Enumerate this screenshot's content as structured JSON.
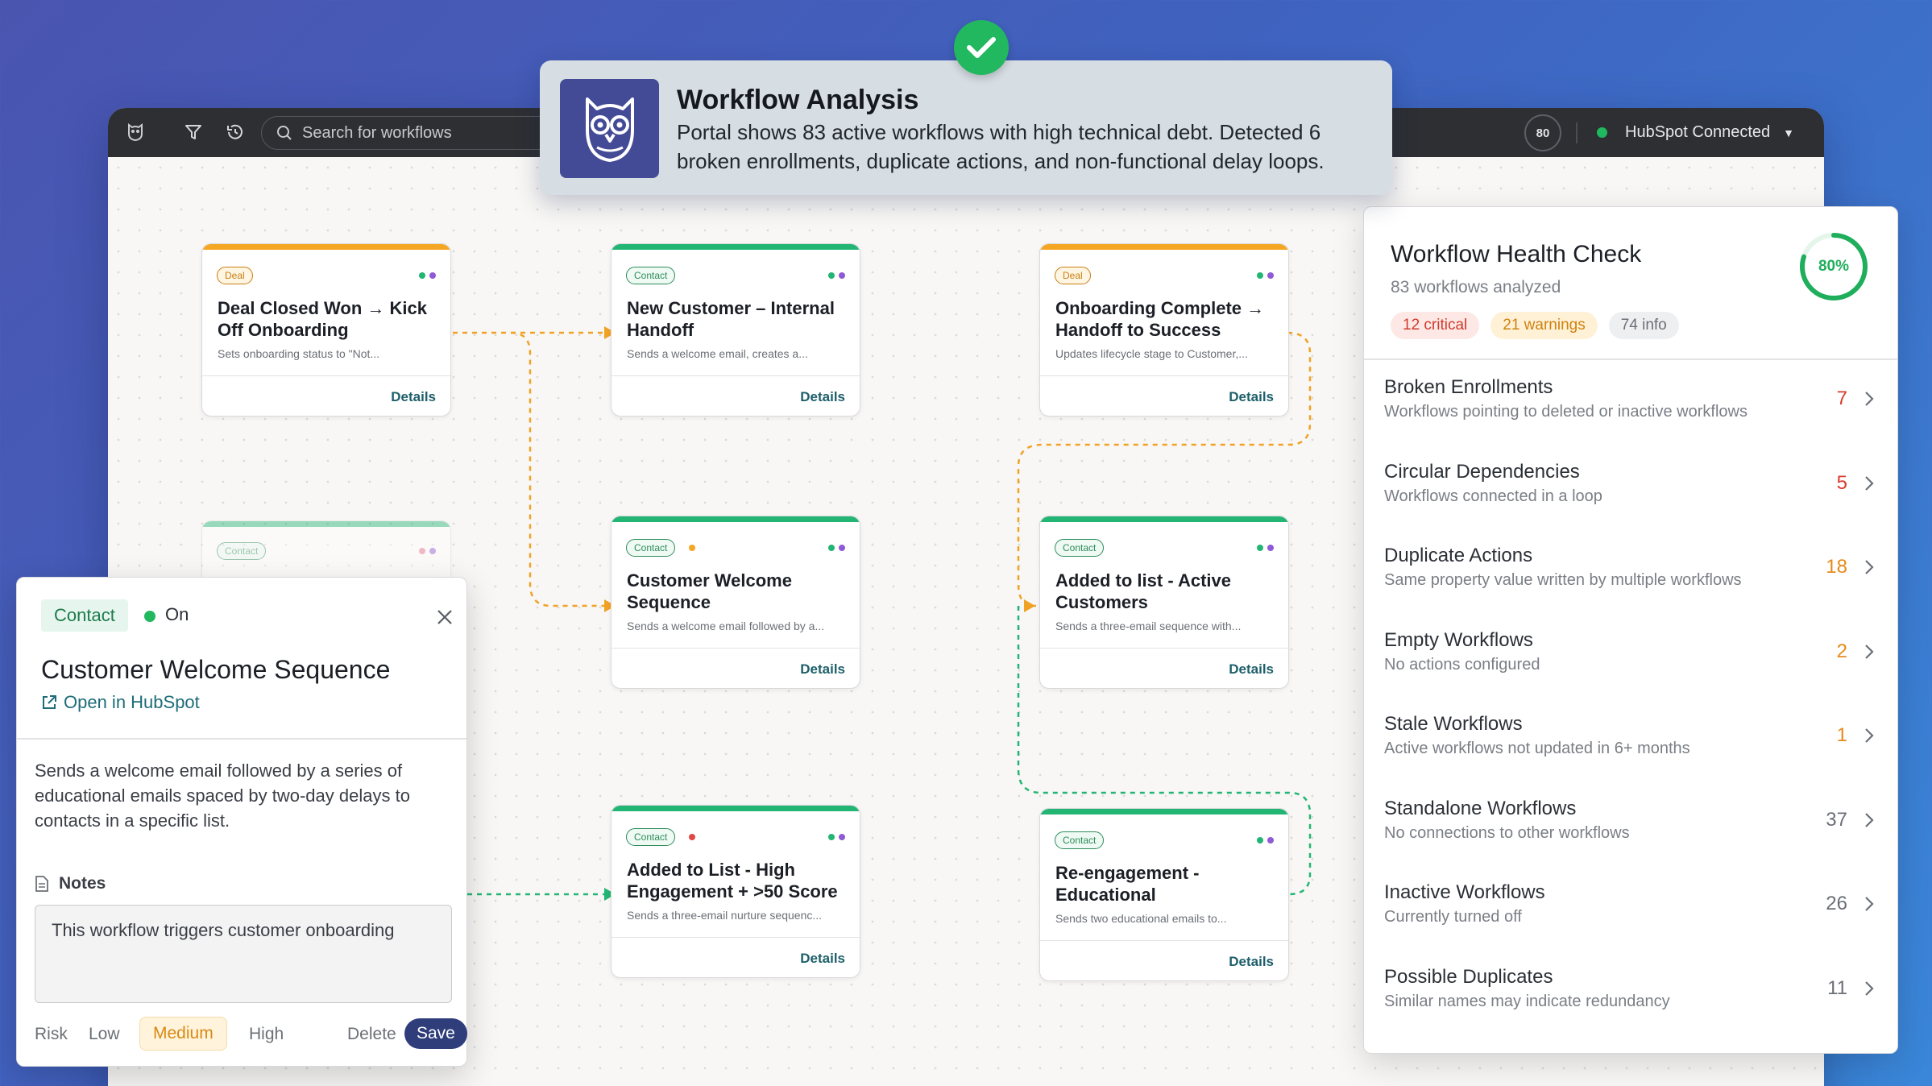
{
  "toolbar": {
    "search_placeholder": "Search for workflows",
    "credits": "80",
    "connection_label": "HubSpot Connected"
  },
  "banner": {
    "title": "Workflow Analysis",
    "text": "Portal shows 83 active workflows with high technical debt. Detected 6 broken enrollments, duplicate actions, and non-functional delay loops."
  },
  "nodes": [
    {
      "tag": "Deal",
      "title": "Deal Closed Won → Kick Off Onboarding",
      "desc": "Sets onboarding status to \"Not...",
      "details": "Details"
    },
    {
      "tag": "Contact",
      "title": "New Customer – Internal Handoff",
      "desc": "Sends a welcome email, creates a...",
      "details": "Details"
    },
    {
      "tag": "Deal",
      "title": "Onboarding Complete → Handoff to Success",
      "desc": "Updates lifecycle stage to Customer,...",
      "details": "Details"
    },
    {
      "tag": "Contact",
      "title": "Customer Welcome Sequence",
      "desc": "Sends a welcome email followed by a...",
      "details": "Details"
    },
    {
      "tag": "Contact",
      "title": "Added to list - Active Customers",
      "desc": "Sends a three-email sequence with...",
      "details": "Details"
    },
    {
      "tag": "Contact",
      "title": "Added to List - High Engagement + >50 Score",
      "desc": "Sends a three-email nurture sequenc...",
      "details": "Details"
    },
    {
      "tag": "Contact",
      "title": "Re-engagement - Educational",
      "desc": "Sends two educational emails to...",
      "details": "Details"
    },
    {
      "tag": "Contact",
      "title": "",
      "desc": "",
      "details": ""
    }
  ],
  "detail_panel": {
    "tag": "Contact",
    "status": "On",
    "title": "Customer Welcome Sequence",
    "link": "Open in HubSpot",
    "description": "Sends a welcome email followed by a series of educational emails spaced by two-day delays to contacts in a specific list.",
    "notes_label": "Notes",
    "notes_value": "This workflow triggers customer onboarding",
    "risk_label": "Risk",
    "risk_options": [
      "Low",
      "Medium",
      "High"
    ],
    "risk_selected": "Medium",
    "delete_label": "Delete",
    "save_label": "Save"
  },
  "health": {
    "title": "Workflow Health Check",
    "subtitle": "83 workflows analyzed",
    "score": "80%",
    "score_fraction": 0.8,
    "badges": {
      "critical": "12 critical",
      "warnings": "21 warnings",
      "info": "74 info"
    },
    "items": [
      {
        "name": "Broken Enrollments",
        "hint": "Workflows pointing to deleted or inactive workflows",
        "count": "7",
        "severity": "critical"
      },
      {
        "name": "Circular Dependencies",
        "hint": "Workflows connected in a loop",
        "count": "5",
        "severity": "critical"
      },
      {
        "name": "Duplicate Actions",
        "hint": "Same property value written by multiple workflows",
        "count": "18",
        "severity": "warning"
      },
      {
        "name": "Empty Workflows",
        "hint": "No actions configured",
        "count": "2",
        "severity": "warning"
      },
      {
        "name": "Stale Workflows",
        "hint": "Active workflows not updated in 6+ months",
        "count": "1",
        "severity": "warning"
      },
      {
        "name": "Standalone Workflows",
        "hint": "No connections to other workflows",
        "count": "37",
        "severity": "info"
      },
      {
        "name": "Inactive Workflows",
        "hint": "Currently turned off",
        "count": "26",
        "severity": "info"
      },
      {
        "name": "Possible Duplicates",
        "hint": "Similar names may indicate redundancy",
        "count": "11",
        "severity": "info"
      }
    ]
  },
  "colors": {
    "deal": "#f5a623",
    "contact": "#22b573",
    "critical": "#d93b2b",
    "warning": "#e8891a",
    "info": "#6b6f76"
  }
}
